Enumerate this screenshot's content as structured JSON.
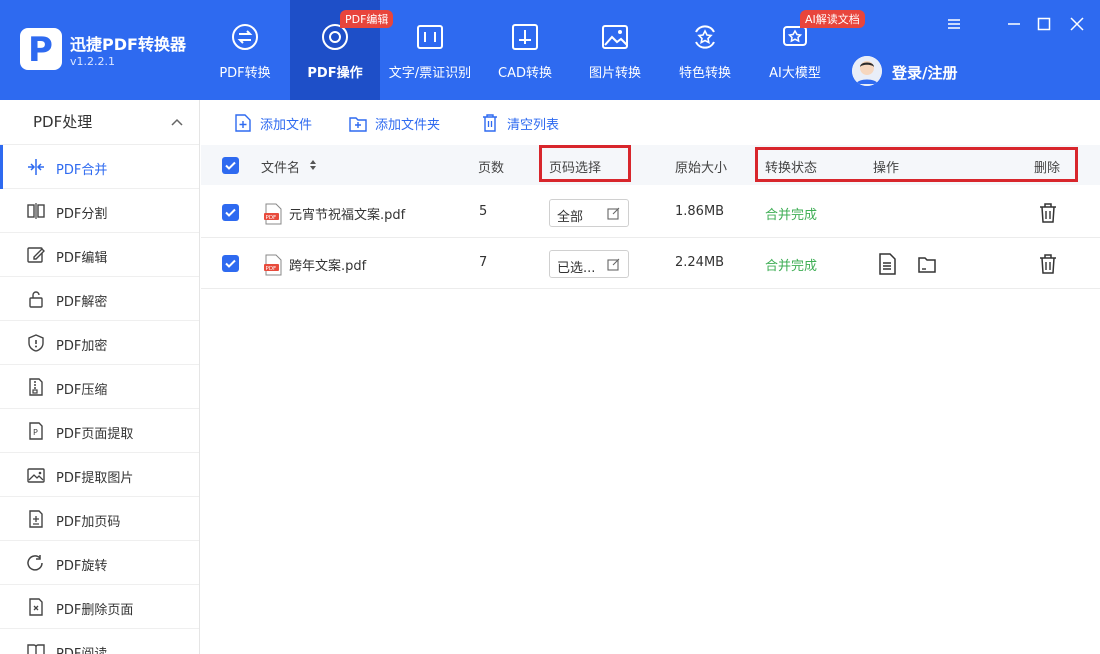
{
  "app": {
    "name": "迅捷PDF转换器",
    "version": "v1.2.2.1"
  },
  "nav": [
    {
      "label": "PDF转换",
      "icon": "pdf-convert-icon"
    },
    {
      "label": "PDF操作",
      "icon": "pdf-operate-icon",
      "badge": "PDF编辑"
    },
    {
      "label": "文字/票证识别",
      "icon": "ocr-icon"
    },
    {
      "label": "CAD转换",
      "icon": "cad-icon"
    },
    {
      "label": "图片转换",
      "icon": "image-icon"
    },
    {
      "label": "特色转换",
      "icon": "special-icon"
    },
    {
      "label": "AI大模型",
      "icon": "ai-icon",
      "badge": "AI解读文档"
    }
  ],
  "user": {
    "login_label": "登录/注册"
  },
  "sidebar": {
    "section_title": "PDF处理",
    "items": [
      {
        "label": "PDF合并",
        "icon": "merge-icon"
      },
      {
        "label": "PDF分割",
        "icon": "split-icon"
      },
      {
        "label": "PDF编辑",
        "icon": "edit-icon"
      },
      {
        "label": "PDF解密",
        "icon": "unlock-icon"
      },
      {
        "label": "PDF加密",
        "icon": "shield-icon"
      },
      {
        "label": "PDF压缩",
        "icon": "compress-icon"
      },
      {
        "label": "PDF页面提取",
        "icon": "page-extract-icon"
      },
      {
        "label": "PDF提取图片",
        "icon": "image-extract-icon"
      },
      {
        "label": "PDF加页码",
        "icon": "page-number-icon"
      },
      {
        "label": "PDF旋转",
        "icon": "rotate-icon"
      },
      {
        "label": "PDF删除页面",
        "icon": "delete-page-icon"
      },
      {
        "label": "PDF阅读",
        "icon": "book-icon"
      }
    ]
  },
  "toolbar": {
    "add_file": "添加文件",
    "add_folder": "添加文件夹",
    "clear_list": "清空列表"
  },
  "table": {
    "headers": {
      "filename": "文件名",
      "pages": "页数",
      "page_range": "页码选择",
      "size": "原始大小",
      "status": "转换状态",
      "actions": "操作",
      "delete": "删除"
    },
    "rows": [
      {
        "filename": "元宵节祝福文案.pdf",
        "pages": "5",
        "page_range": "全部",
        "size": "1.86MB",
        "status": "合并完成"
      },
      {
        "filename": "跨年文案.pdf",
        "pages": "7",
        "page_range": "已选...",
        "size": "2.24MB",
        "status": "合并完成"
      }
    ]
  },
  "colors": {
    "primary": "#2e6af0",
    "active_nav": "#1e4fc8",
    "status_done": "#3fae55",
    "highlight": "#d8262c"
  }
}
